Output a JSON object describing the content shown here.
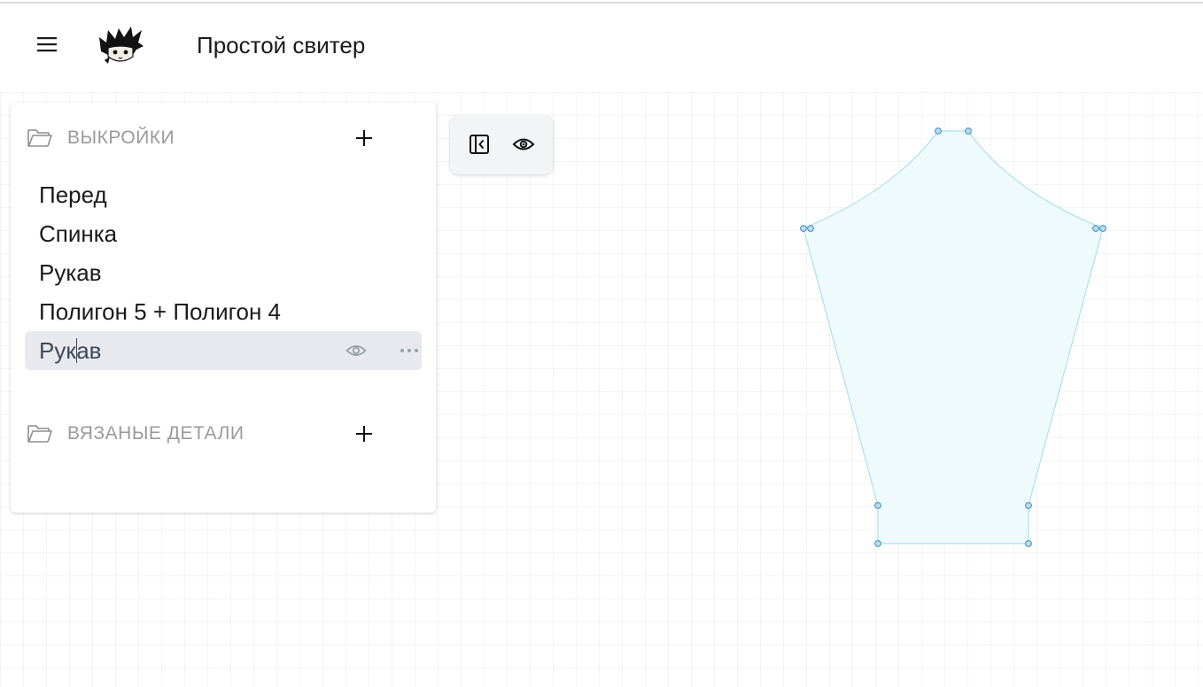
{
  "header": {
    "title": "Простой свитер",
    "menu_icon": "hamburger-icon",
    "logo_icon": "cat-logo-icon"
  },
  "sidebar": {
    "patterns_section": {
      "title": "ВЫКРОЙКИ",
      "icon": "folder-open-icon",
      "add_icon": "plus-icon",
      "items": [
        {
          "label": "Перед"
        },
        {
          "label": "Спинка"
        },
        {
          "label": "Рукав"
        },
        {
          "label": "Полигон 5 + Полигон 4"
        }
      ],
      "editing_item": {
        "label_before_caret": "Рук",
        "label_after_caret": "ав",
        "visibility_icon": "eye-icon",
        "more_icon": "more-dots-icon"
      }
    },
    "knitted_section": {
      "title": "ВЯЗАНЫЕ ДЕТАЛИ",
      "icon": "folder-open-icon",
      "add_icon": "plus-icon"
    }
  },
  "toolbar": {
    "collapse_icon": "collapse-panel-icon",
    "view_icon": "eye-icon"
  },
  "colors": {
    "shape_fill": "#eefafc",
    "shape_stroke": "#aee1e8",
    "handle_fill": "#b7dcef",
    "handle_stroke": "#3c8ec0",
    "selected_row": "#e7e9ee",
    "section_title": "#9a9a9a"
  }
}
